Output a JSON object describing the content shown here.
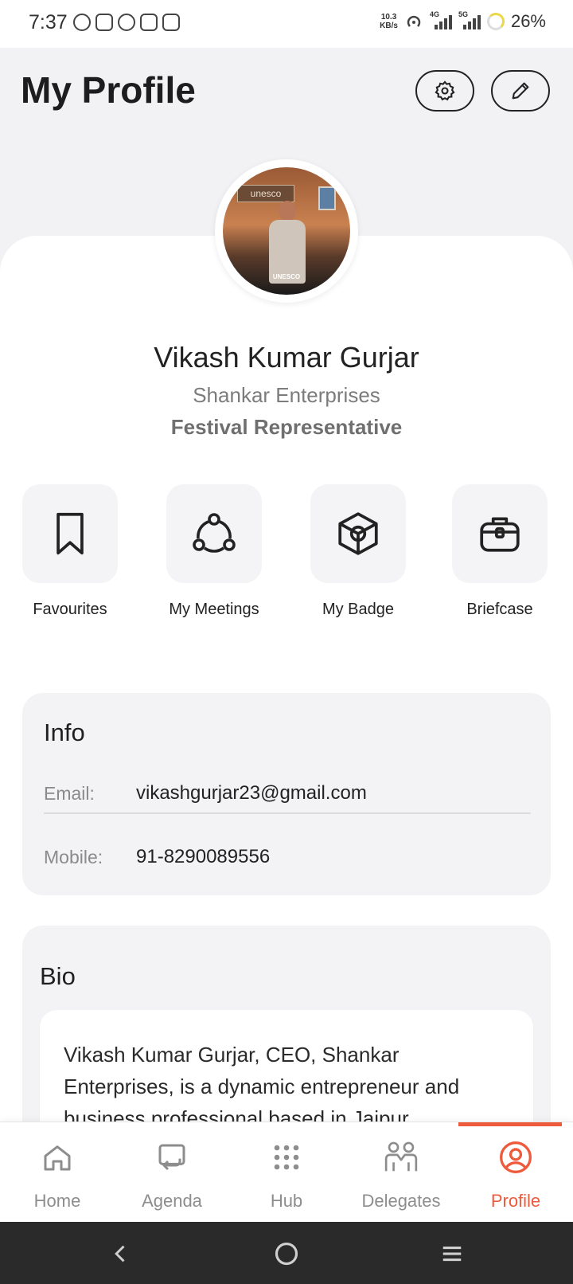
{
  "status_bar": {
    "time": "7:37",
    "net_speed_value": "10.3",
    "net_speed_unit": "KB/s",
    "sim1_label": "4G",
    "sim2_label": "5G",
    "battery": "26%"
  },
  "header": {
    "title": "My Profile",
    "settings_icon": "gear-icon",
    "edit_icon": "pencil-icon"
  },
  "profile": {
    "photo_sign_text": "unesco",
    "photo_caption": "UNESCO",
    "name": "Vikash Kumar Gurjar",
    "company": "Shankar Enterprises",
    "role": "Festival Representative"
  },
  "quick_actions": [
    {
      "label": "Favourites",
      "icon": "bookmark-icon"
    },
    {
      "label": "My Meetings",
      "icon": "meetings-icon"
    },
    {
      "label": "My Badge",
      "icon": "badge-icon"
    },
    {
      "label": "Briefcase",
      "icon": "briefcase-icon"
    }
  ],
  "info": {
    "title": "Info",
    "email_label": "Email:",
    "email_value": "vikashgurjar23@gmail.com",
    "mobile_label": "Mobile:",
    "mobile_value": "91-8290089556"
  },
  "bio": {
    "title": "Bio",
    "text": "Vikash Kumar Gurjar, CEO, Shankar Enterprises, is a dynamic entrepreneur and business professional based in Jaipur"
  },
  "bottom_nav": {
    "active": "Profile",
    "items": [
      {
        "label": "Home",
        "icon": "home-icon"
      },
      {
        "label": "Agenda",
        "icon": "agenda-icon"
      },
      {
        "label": "Hub",
        "icon": "grid-icon"
      },
      {
        "label": "Delegates",
        "icon": "delegates-icon"
      },
      {
        "label": "Profile",
        "icon": "profile-icon"
      }
    ]
  },
  "colors": {
    "accent": "#ee5a3c",
    "background": "#f2f2f4",
    "card": "#ffffff"
  }
}
